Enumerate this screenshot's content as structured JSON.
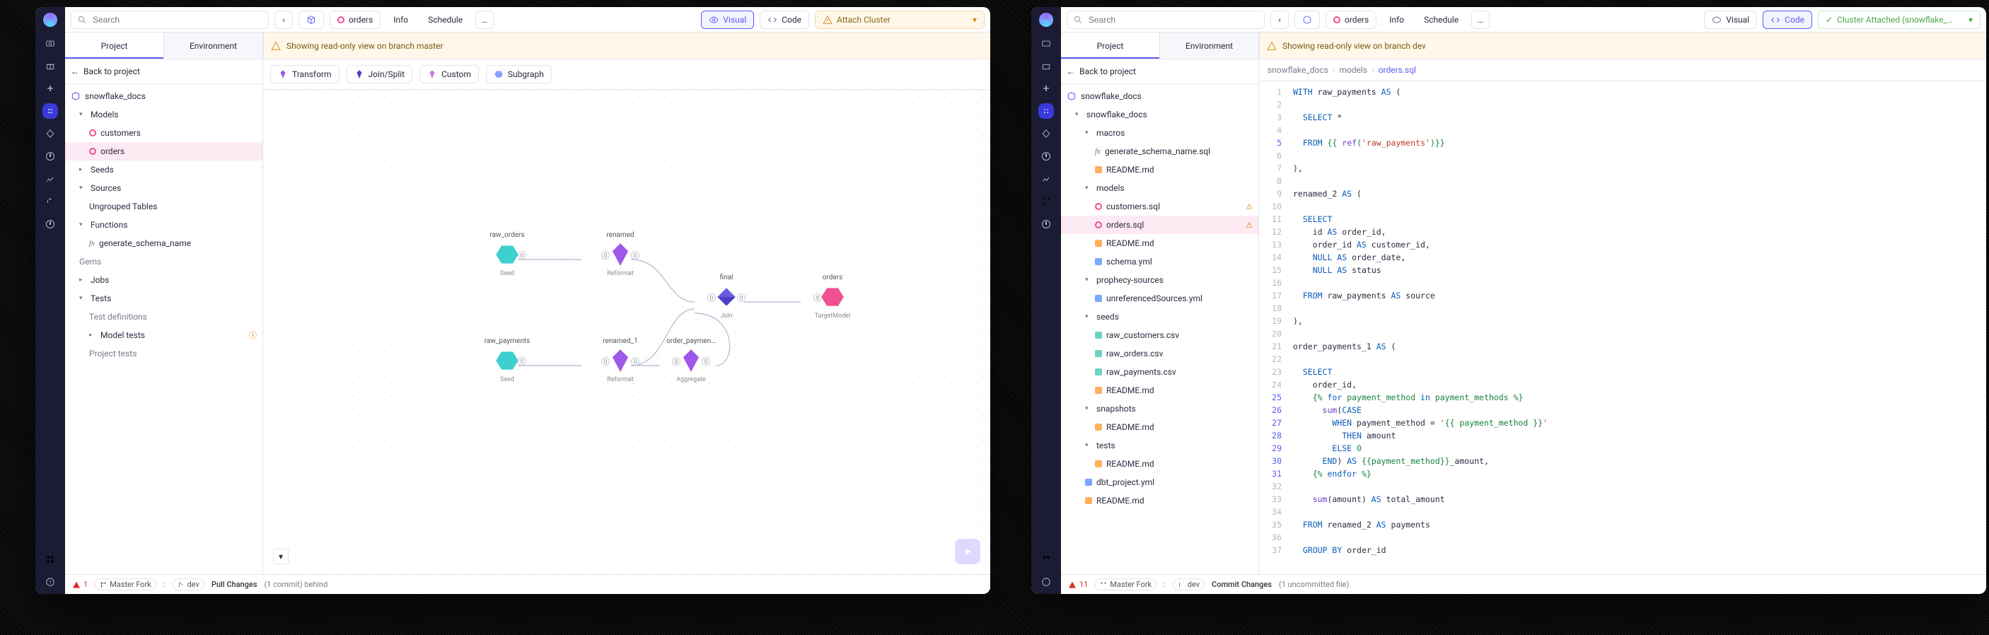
{
  "left": {
    "search_placeholder": "Search",
    "back_icon": "‹",
    "cube_color": "#5b5bf5",
    "file_name": "orders",
    "tabs_top": [
      "Info",
      "Schedule"
    ],
    "more": "…",
    "visual_label": "Visual",
    "code_label": "Code",
    "attach_label": "Attach Cluster",
    "tab_project": "Project",
    "tab_env": "Environment",
    "banner": "Showing read-only view on branch master",
    "tools": {
      "transform": "Transform",
      "joinsplit": "Join/Split",
      "custom": "Custom",
      "subgraph": "Subgraph"
    },
    "back_to_project": "Back to project",
    "project_name": "snowflake_docs",
    "tree": {
      "models": "Models",
      "customers": "customers",
      "orders": "orders",
      "seeds": "Seeds",
      "sources": "Sources",
      "ungrouped": "Ungrouped Tables",
      "functions": "Functions",
      "gen_schema": "generate_schema_name",
      "gems": "Gems",
      "jobs": "Jobs",
      "tests": "Tests",
      "test_defs": "Test definitions",
      "model_tests": "Model tests",
      "project_tests": "Project tests"
    },
    "nodes": {
      "raw_orders": "raw_orders",
      "renamed": "renamed",
      "final": "final",
      "orders": "orders",
      "raw_payments": "raw_payments",
      "renamed_1": "renamed_1",
      "order_paymen": "order_paymen…",
      "seed": "Seed",
      "reformat": "Reformat",
      "join": "Join",
      "aggregate": "Aggregate",
      "target": "TargetModel"
    },
    "footer": {
      "errors": "1",
      "master_fork": "Master Fork",
      "branch": "dev",
      "pull": "Pull Changes",
      "pull_meta": "(1 commit) behind"
    }
  },
  "right": {
    "search_placeholder": "Search",
    "file_name": "orders",
    "tabs_top": [
      "Info",
      "Schedule"
    ],
    "more": "…",
    "visual_label": "Visual",
    "code_label": "Code",
    "cluster_label": "Cluster Attached (snowflake_…",
    "tab_project": "Project",
    "tab_env": "Environment",
    "banner": "Showing read-only view on branch dev",
    "back_to_project": "Back to project",
    "project_name": "snowflake_docs",
    "crumbs": [
      "snowflake_docs",
      "models",
      "orders.sql"
    ],
    "tree": {
      "root": "snowflake_docs",
      "macros": "macros",
      "gen_schema": "generate_schema_name.sql",
      "readme": "README.md",
      "models": "models",
      "customers_sql": "customers.sql",
      "orders_sql": "orders.sql",
      "schema_yml": "schema.yml",
      "prophecy_sources": "prophecy-sources",
      "unref_yml": "unreferencedSources.yml",
      "seeds": "seeds",
      "raw_customers_csv": "raw_customers.csv",
      "raw_orders_csv": "raw_orders.csv",
      "raw_payments_csv": "raw_payments.csv",
      "snapshots": "snapshots",
      "tests": "tests",
      "dbt_project": "dbt_project.yml",
      "readme_md": "README.md"
    },
    "code_lines": [
      {
        "n": 1,
        "t": "WITH raw_payments AS ("
      },
      {
        "n": 2,
        "t": ""
      },
      {
        "n": 3,
        "t": "  SELECT *"
      },
      {
        "n": 4,
        "t": ""
      },
      {
        "n": 5,
        "t": "  FROM {{ ref('raw_payments')}}",
        "hi": true
      },
      {
        "n": 6,
        "t": ""
      },
      {
        "n": 7,
        "t": "),"
      },
      {
        "n": 8,
        "t": ""
      },
      {
        "n": 9,
        "t": "renamed_2 AS ("
      },
      {
        "n": 10,
        "t": ""
      },
      {
        "n": 11,
        "t": "  SELECT"
      },
      {
        "n": 12,
        "t": "    id AS order_id,"
      },
      {
        "n": 13,
        "t": "    order_id AS customer_id,"
      },
      {
        "n": 14,
        "t": "    NULL AS order_date,"
      },
      {
        "n": 15,
        "t": "    NULL AS status"
      },
      {
        "n": 16,
        "t": ""
      },
      {
        "n": 17,
        "t": "  FROM raw_payments AS source"
      },
      {
        "n": 18,
        "t": ""
      },
      {
        "n": 19,
        "t": "),"
      },
      {
        "n": 20,
        "t": ""
      },
      {
        "n": 21,
        "t": "order_payments_1 AS ("
      },
      {
        "n": 22,
        "t": ""
      },
      {
        "n": 23,
        "t": "  SELECT"
      },
      {
        "n": 24,
        "t": "    order_id,"
      },
      {
        "n": 25,
        "t": "    {% for payment_method in payment_methods %}",
        "hi": true
      },
      {
        "n": 26,
        "t": "      sum(CASE",
        "hi": true
      },
      {
        "n": 27,
        "t": "        WHEN payment_method = '{{ payment_method }}'",
        "hi": true
      },
      {
        "n": 28,
        "t": "          THEN amount",
        "hi": true
      },
      {
        "n": 29,
        "t": "        ELSE 0",
        "hi": true
      },
      {
        "n": 30,
        "t": "      END) AS {{payment_method}}_amount,",
        "hi": true
      },
      {
        "n": 31,
        "t": "    {% endfor %}",
        "hi": true
      },
      {
        "n": 32,
        "t": ""
      },
      {
        "n": 33,
        "t": "    sum(amount) AS total_amount"
      },
      {
        "n": 34,
        "t": ""
      },
      {
        "n": 35,
        "t": "  FROM renamed_2 AS payments"
      },
      {
        "n": 36,
        "t": ""
      },
      {
        "n": 37,
        "t": "  GROUP BY order_id"
      }
    ],
    "footer": {
      "errors": "11",
      "master_fork": "Master Fork",
      "branch": "dev",
      "commit": "Commit Changes",
      "commit_meta": "(1 uncommitted file)"
    }
  }
}
